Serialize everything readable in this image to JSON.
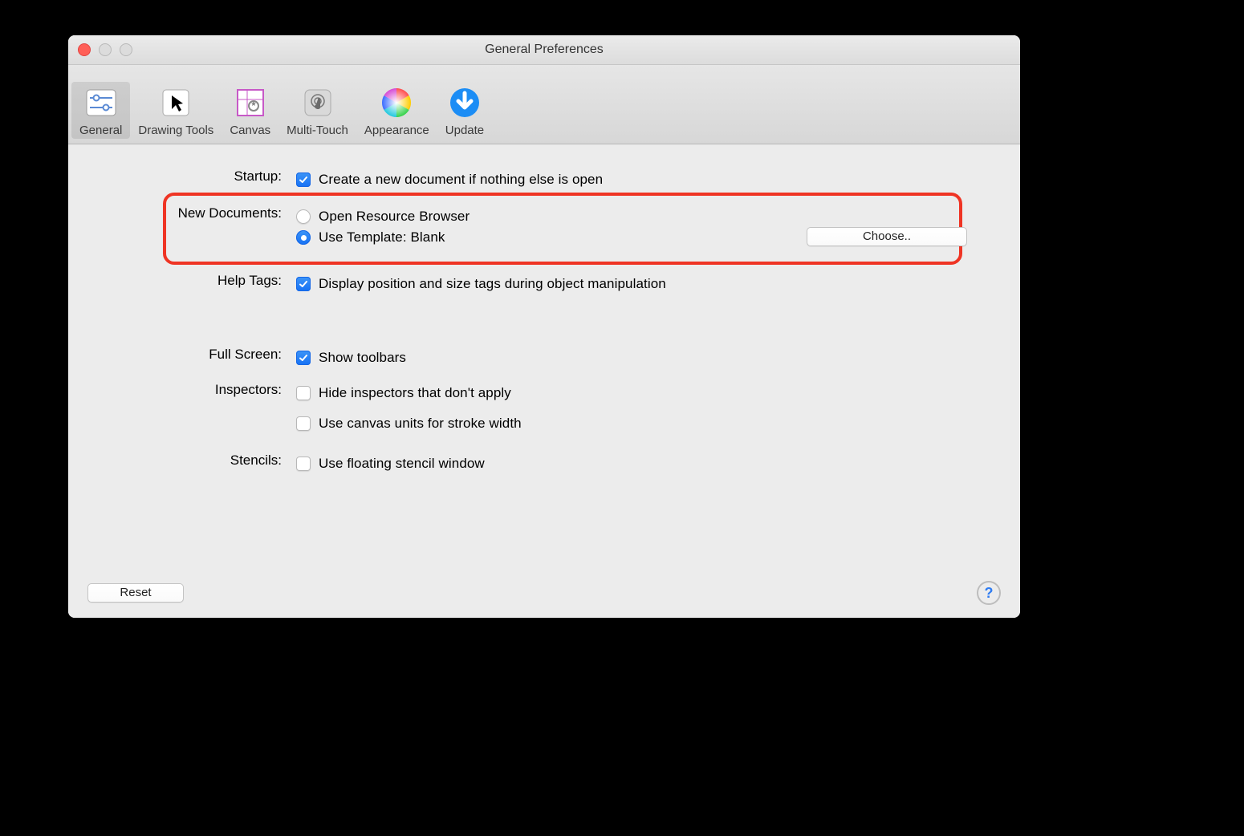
{
  "window": {
    "title": "General Preferences"
  },
  "toolbar": {
    "items": [
      {
        "label": "General"
      },
      {
        "label": "Drawing Tools"
      },
      {
        "label": "Canvas"
      },
      {
        "label": "Multi-Touch"
      },
      {
        "label": "Appearance"
      },
      {
        "label": "Update"
      }
    ],
    "selected_index": 0
  },
  "sections": {
    "startup": {
      "label": "Startup:",
      "create_new": {
        "label": "Create a new document if nothing else is open",
        "checked": true
      }
    },
    "new_documents": {
      "label": "New Documents:",
      "open_browser": {
        "label": "Open Resource Browser",
        "selected": false
      },
      "use_template": {
        "label": "Use Template: Blank",
        "selected": true
      },
      "choose_label": "Choose.."
    },
    "help_tags": {
      "label": "Help Tags:",
      "display_tags": {
        "label": "Display position and size tags during object manipulation",
        "checked": true
      }
    },
    "full_screen": {
      "label": "Full Screen:",
      "show_toolbars": {
        "label": "Show toolbars",
        "checked": true
      }
    },
    "inspectors": {
      "label": "Inspectors:",
      "hide_inspectors": {
        "label": "Hide inspectors that don't apply",
        "checked": false
      },
      "canvas_units": {
        "label": "Use canvas units for stroke width",
        "checked": false
      }
    },
    "stencils": {
      "label": "Stencils:",
      "floating": {
        "label": "Use floating stencil window",
        "checked": false
      }
    }
  },
  "footer": {
    "reset_label": "Reset",
    "help_symbol": "?"
  }
}
